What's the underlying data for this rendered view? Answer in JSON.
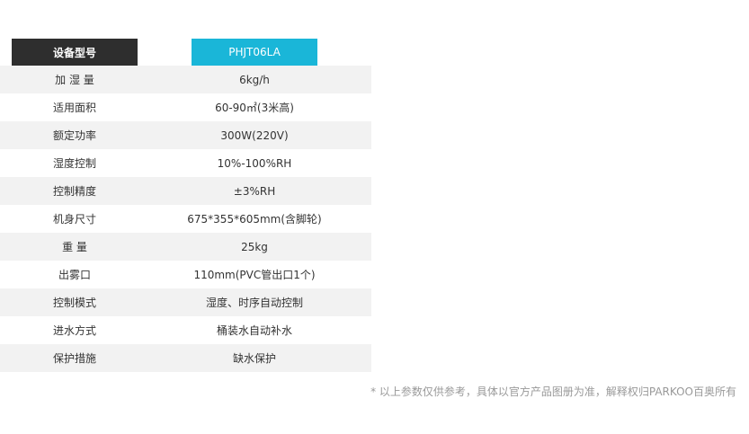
{
  "header": {
    "label": "设备型号",
    "model": "PHJT06LA"
  },
  "rows": [
    {
      "label": "加 湿 量",
      "value": "6kg/h"
    },
    {
      "label": "适用面积",
      "value": "60-90㎡(3米高)"
    },
    {
      "label": "额定功率",
      "value": "300W(220V)"
    },
    {
      "label": "湿度控制",
      "value": "10%-100%RH"
    },
    {
      "label": "控制精度",
      "value": "±3%RH"
    },
    {
      "label": "机身尺寸",
      "value": "675*355*605mm(含脚轮)"
    },
    {
      "label": "重 量",
      "value": "25kg"
    },
    {
      "label": "出雾口",
      "value": "110mm(PVC管出口1个)"
    },
    {
      "label": "控制模式",
      "value": "湿度、时序自动控制"
    },
    {
      "label": "进水方式",
      "value": "桶装水自动补水"
    },
    {
      "label": "保护措施",
      "value": "缺水保护"
    }
  ],
  "footnote": "* 以上参数仅供参考，具体以官方产品图册为准，解释权归PARKOO百奥所有",
  "colors": {
    "header_dark": "#2e2e2e",
    "header_accent": "#1ab6d8",
    "row_shade": "#f2f2f2"
  }
}
